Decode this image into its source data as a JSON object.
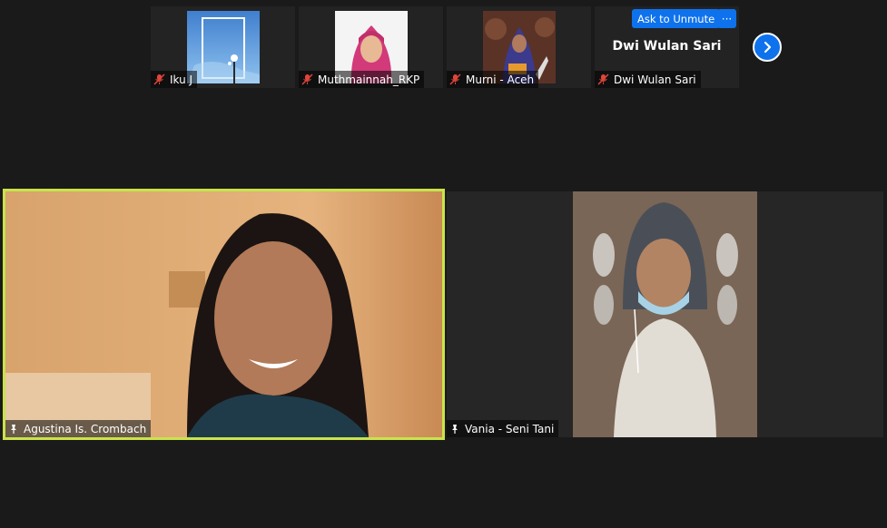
{
  "gallery_strip": {
    "participants": [
      {
        "name": "Iku J"
      },
      {
        "name": "Muthmainnah_RKP"
      },
      {
        "name": "Murni - Aceh"
      },
      {
        "name": "Dwi Wulan Sari",
        "display_name": "Dwi Wulan Sari",
        "ask_unmute_label": "Ask to Unmute",
        "more_label": "···"
      }
    ]
  },
  "main_view": {
    "speaker": {
      "name": "Agustina Is. Crombach"
    },
    "second": {
      "name": "Vania - Seni Tani"
    }
  },
  "colors": {
    "background": "#1a1a1a",
    "tile": "#232323",
    "accent_blue": "#0e72ed",
    "active_speaker_border": "#c9e34a",
    "muted_red": "#e0453a"
  },
  "icons": {
    "muted_mic": "mic-muted-icon",
    "pin": "pin-icon",
    "next": "chevron-right-icon"
  }
}
